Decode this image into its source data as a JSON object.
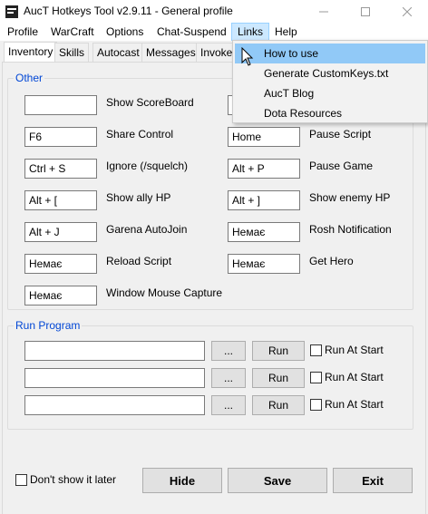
{
  "window": {
    "title": "AucT Hotkeys Tool v2.9.11 - General profile"
  },
  "menubar": {
    "items": [
      {
        "label": "Profile"
      },
      {
        "label": "WarCraft"
      },
      {
        "label": "Options"
      },
      {
        "label": "Chat-Suspend"
      },
      {
        "label": "Links"
      },
      {
        "label": "Help"
      }
    ]
  },
  "tabs": [
    {
      "label": "Inventory"
    },
    {
      "label": "Skills"
    },
    {
      "label": "Autocast"
    },
    {
      "label": "Messages"
    },
    {
      "label": "Invoker"
    }
  ],
  "links_menu": {
    "items": [
      {
        "label": "How to use"
      },
      {
        "label": "Generate CustomKeys.txt"
      },
      {
        "label": "AucT Blog"
      },
      {
        "label": "Dota Resources"
      }
    ]
  },
  "other_group": {
    "legend": "Other",
    "left": [
      {
        "value": "",
        "label": "Show ScoreBoard"
      },
      {
        "value": "F6",
        "label": "Share Control"
      },
      {
        "value": "Ctrl + S",
        "label": "Ignore (/squelch)"
      },
      {
        "value": "Alt + [",
        "label": "Show ally HP"
      },
      {
        "value": "Alt + J",
        "label": "Garena AutoJoin"
      },
      {
        "value": "Немає",
        "label": "Reload Script"
      },
      {
        "value": "Немає",
        "label": "Window Mouse Capture"
      }
    ],
    "right": [
      {
        "value": "Home",
        "label": "Pause Script"
      },
      {
        "value": "Alt + P",
        "label": "Pause Game"
      },
      {
        "value": "Alt + ]",
        "label": "Show enemy HP"
      },
      {
        "value": "Немає",
        "label": "Rosh Notification"
      },
      {
        "value": "Немає",
        "label": "Get Hero"
      }
    ]
  },
  "run_group": {
    "legend": "Run Program",
    "browse_label": "...",
    "run_label": "Run",
    "checkbox_label": "Run At Start",
    "rows": [
      {
        "path": ""
      },
      {
        "path": ""
      },
      {
        "path": ""
      }
    ]
  },
  "footer": {
    "dont_show_label": "Don't show it later",
    "hide_label": "Hide",
    "save_label": "Save",
    "exit_label": "Exit"
  }
}
